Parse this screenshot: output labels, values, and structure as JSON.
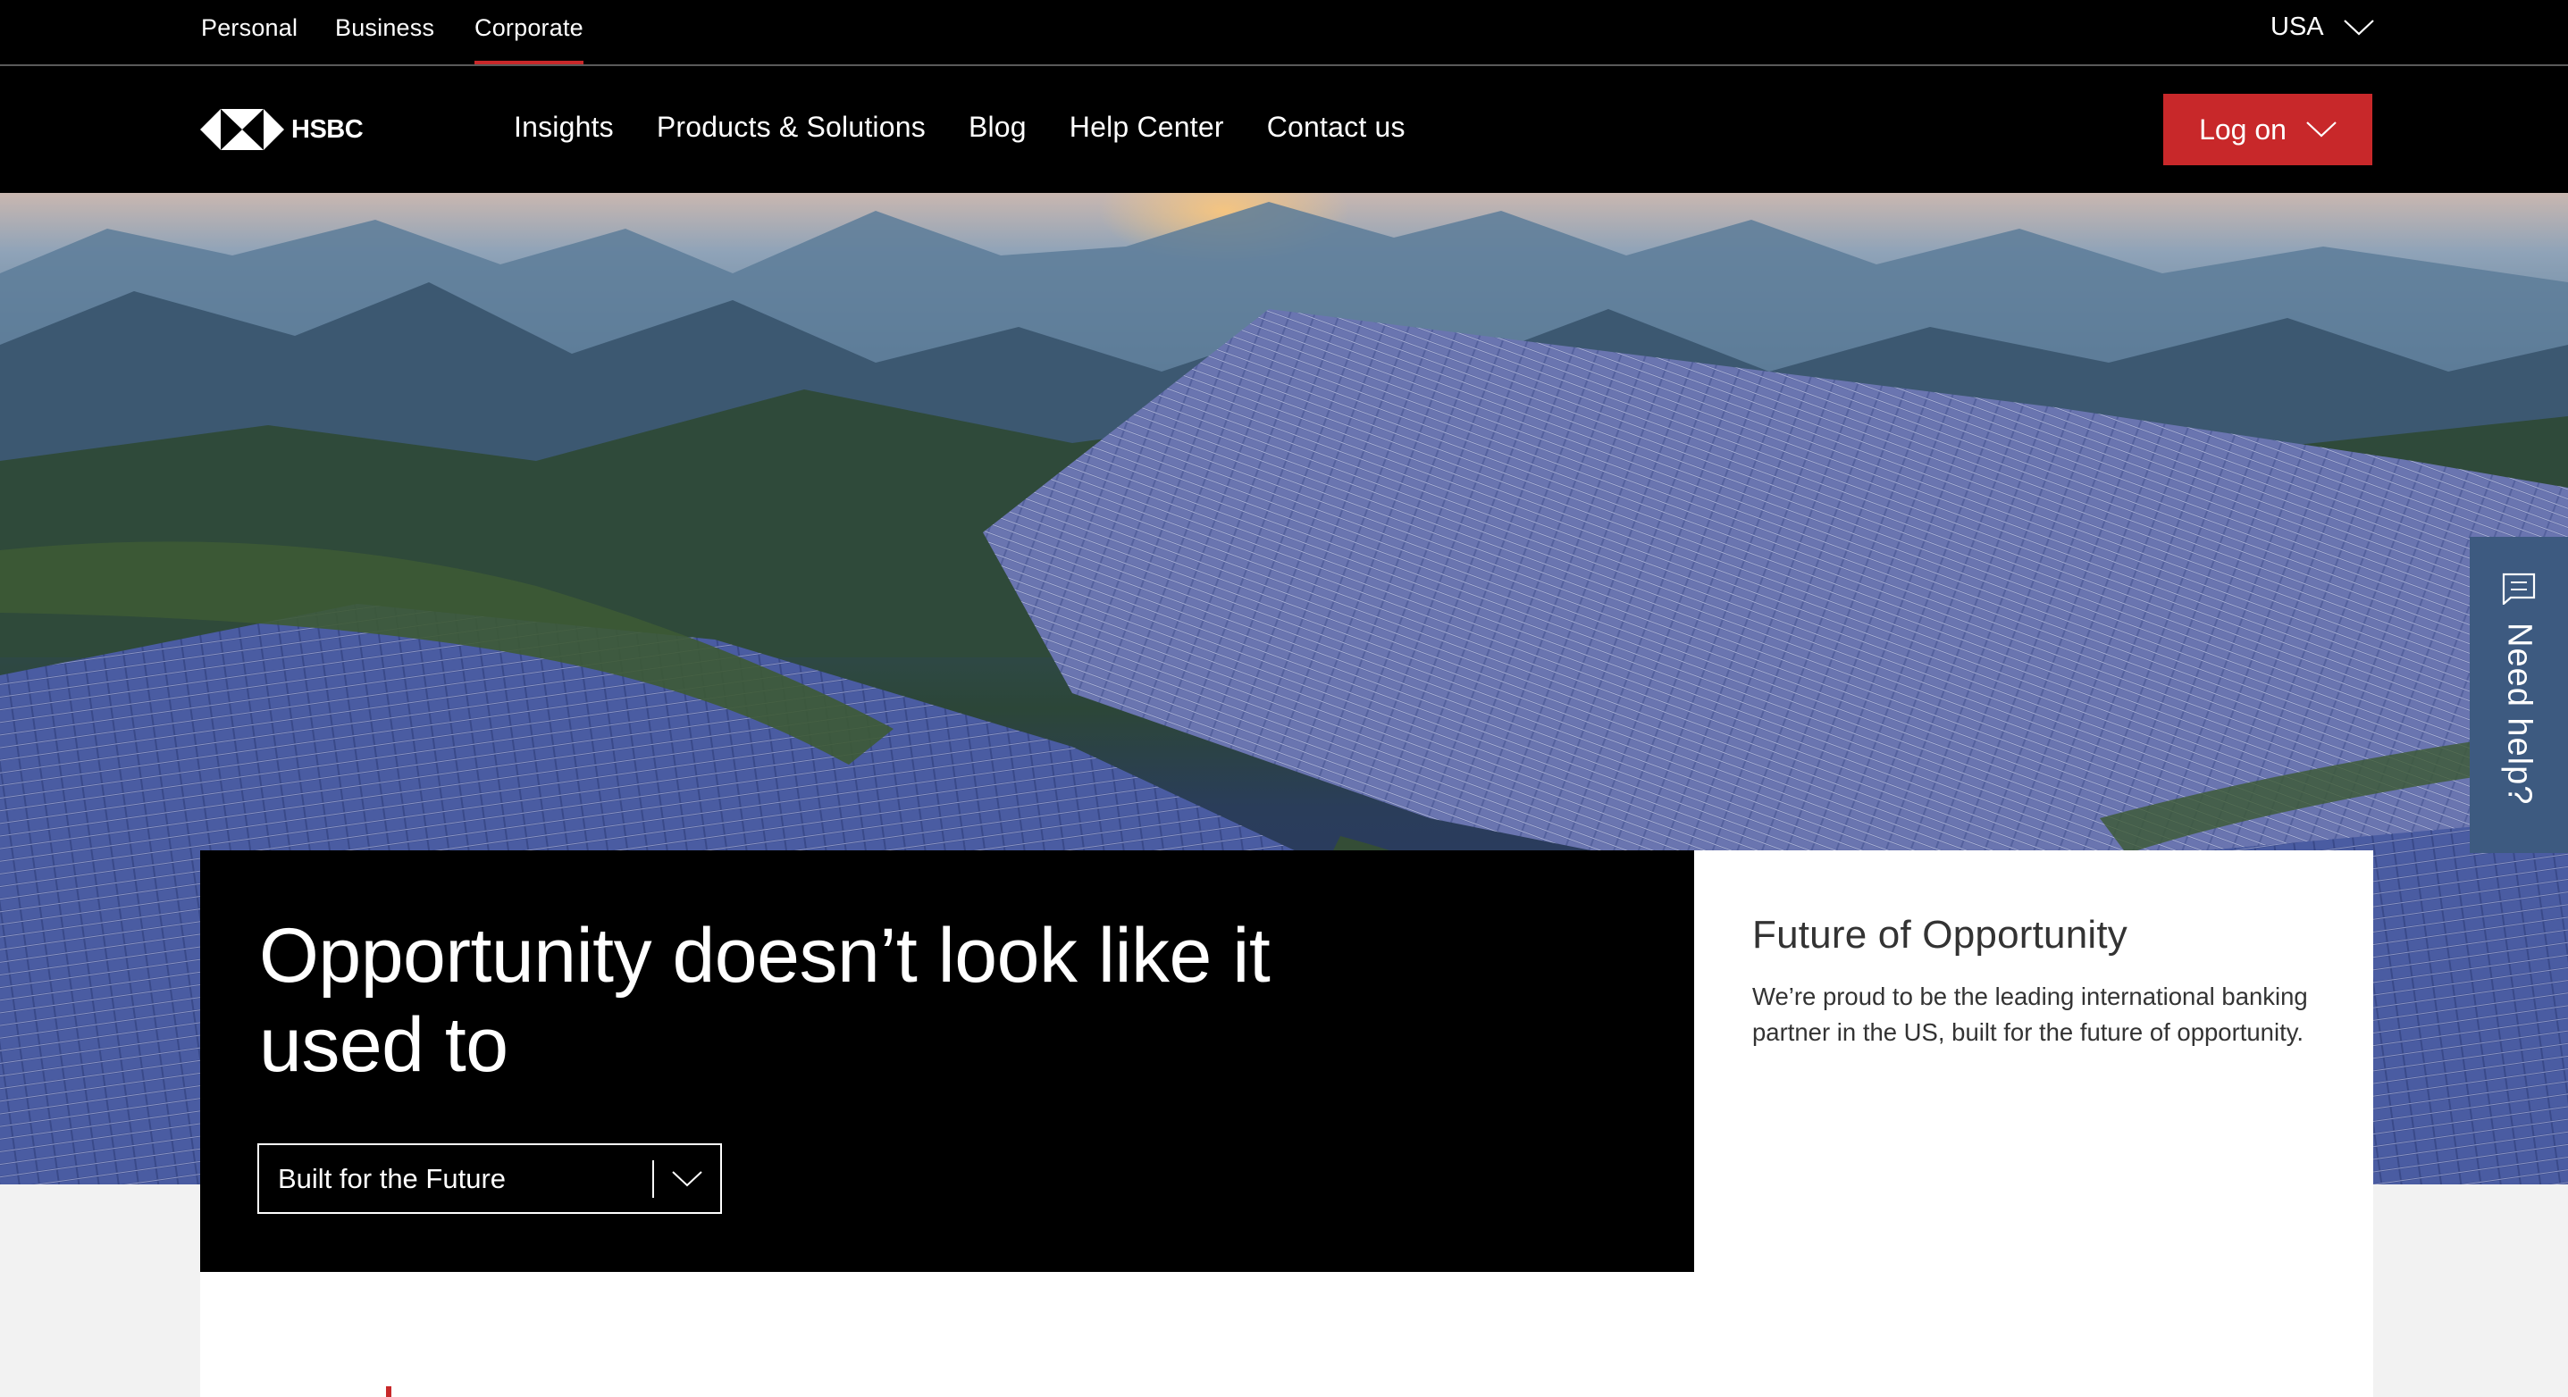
{
  "colors": {
    "brand_red": "#c8282a",
    "help_blue": "#3d5a80",
    "header_bg": "#000000",
    "page_bg": "#f2f2f2"
  },
  "topbar": {
    "segments": [
      {
        "label": "Personal",
        "active": false
      },
      {
        "label": "Business",
        "active": false
      },
      {
        "label": "Corporate",
        "active": true
      }
    ],
    "country": {
      "label": "USA",
      "icon": "chevron-down-icon"
    }
  },
  "header": {
    "logo": {
      "wordmark": "HSBC",
      "icon": "hsbc-hexagon-logo"
    },
    "nav": [
      {
        "label": "Insights"
      },
      {
        "label": "Products & Solutions"
      },
      {
        "label": "Blog"
      },
      {
        "label": "Help Center"
      },
      {
        "label": "Contact us"
      }
    ],
    "logon": {
      "label": "Log on",
      "icon": "chevron-down-icon"
    }
  },
  "hero": {
    "image_alt": "Solar panels covering mountain ridges at sunrise",
    "headline": "Opportunity doesn’t look like it used to",
    "selector": {
      "value": "Built for the Future",
      "icon": "chevron-down-icon"
    }
  },
  "card": {
    "title": "Future of Opportunity",
    "body": "We’re proud to be the leading international banking partner in the US, built for the future of opportunity."
  },
  "help_tab": {
    "label": "Need help?",
    "icon": "chat-icon"
  }
}
